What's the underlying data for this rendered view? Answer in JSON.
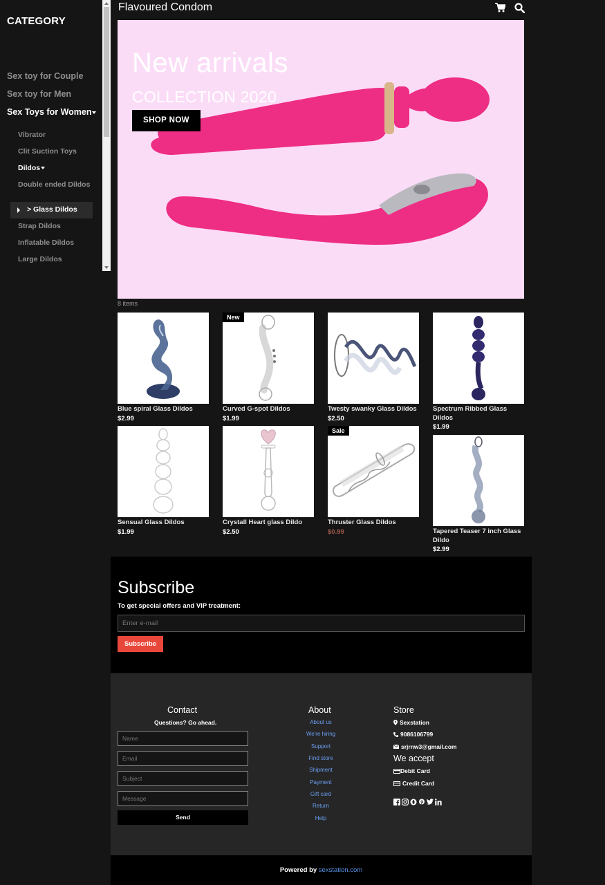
{
  "sidebar": {
    "title": "CATEGORY",
    "categories": [
      "Sex toy for Couple",
      "Sex toy for Men",
      "Sex Toys for Women"
    ],
    "subcategories": [
      "Vibrator",
      "Clit Suction Toys",
      "Dildos",
      "Double ended Dildos",
      "> Glass Dildos",
      "Strap Dildos",
      "Inflatable Dildos",
      "Large Dildos"
    ]
  },
  "header": {
    "site_title": "Flavoured Condom",
    "cart_icon": "cart-icon",
    "search_icon": "search-icon"
  },
  "hero": {
    "headline": "New arrivals",
    "subheadline": "COLLECTION 2020",
    "button_label": "SHOP NOW",
    "background_color": "#fbdcf7",
    "product_color": "#ee2d84"
  },
  "listing": {
    "items_count": "8 items",
    "products": [
      {
        "name": "Blue spiral Glass Dildos",
        "price": "$2.99",
        "badge": ""
      },
      {
        "name": "Curved G-spot Dildos",
        "price": "$1.99",
        "badge": "New"
      },
      {
        "name": "Twesty swanky Glass Dildos",
        "price": "$2.50",
        "badge": ""
      },
      {
        "name": "Spectrum Ribbed Glass Dildos",
        "price": "$1.99",
        "badge": ""
      },
      {
        "name": "Sensual Glass Dildos",
        "price": "$1.99",
        "badge": ""
      },
      {
        "name": "Crystall Heart glass Dildo",
        "price": "$2.50",
        "badge": ""
      },
      {
        "name": "Thruster Glass Dildos",
        "price": "$0.99",
        "badge": "Sale"
      },
      {
        "name": "Tapered Teaser 7 inch Glass Dildo",
        "price": "$2.99",
        "badge": ""
      }
    ]
  },
  "subscribe": {
    "title": "Subscribe",
    "text": "To get special offers and VIP treatment:",
    "placeholder": "Enter e-mail",
    "button_label": "Subscribe",
    "button_color": "#e8473a"
  },
  "footer": {
    "contact": {
      "title": "Contact",
      "subtitle": "Questions? Go ahead.",
      "name_placeholder": "Name",
      "email_placeholder": "Email",
      "subject_placeholder": "Subject",
      "message_placeholder": "Message",
      "send_label": "Send"
    },
    "about": {
      "title": "About",
      "links": [
        "About us",
        "We're hiring",
        "Support",
        "Find store",
        "Shipment",
        "Payment",
        "Gift card",
        "Return",
        "Help"
      ],
      "link_color": "#6a9ff0"
    },
    "store": {
      "title": "Store",
      "name": "Sexstation",
      "phone": "9086106799",
      "email": "srjrnw3@gmail.com",
      "accept_title": "We accept",
      "payment_methods": [
        "Debit Card",
        "Credit Card"
      ],
      "social_icons": [
        "facebook-icon",
        "instagram-icon",
        "opera-icon",
        "pinterest-icon",
        "twitter-icon",
        "linkedin-icon"
      ]
    }
  },
  "powered": {
    "text": "Powered by",
    "link": "sexstation.com"
  }
}
